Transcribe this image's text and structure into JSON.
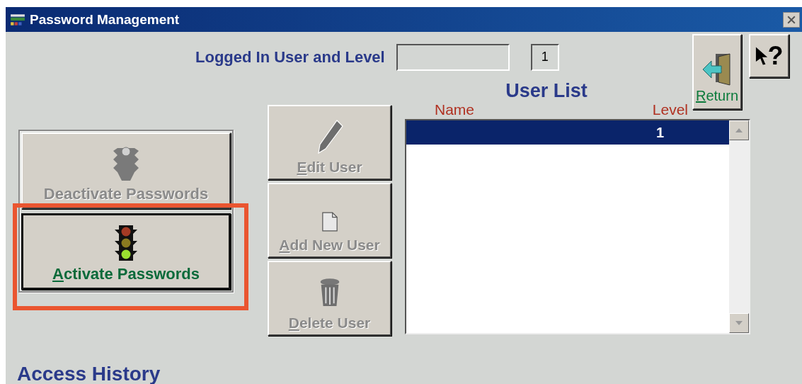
{
  "window": {
    "title": "Password Management"
  },
  "login": {
    "label": "Logged In User and Level",
    "level": "1"
  },
  "side_buttons": [
    {
      "kind": "deactivate",
      "label": "Deactivate Passwords",
      "disabled": true
    },
    {
      "kind": "activate",
      "label": "Activate Passwords",
      "disabled": false
    }
  ],
  "user_buttons": [
    {
      "kind": "edit",
      "label": "Edit User",
      "disabled": true
    },
    {
      "kind": "add",
      "label": "Add New User",
      "disabled": true
    },
    {
      "kind": "delete",
      "label": "Delete User",
      "disabled": true
    }
  ],
  "return_button": {
    "label": "Return",
    "disabled": false
  },
  "help_button": {
    "glyph": "?"
  },
  "user_list": {
    "title": "User List",
    "columns": [
      "Name",
      "Level"
    ],
    "rows": [
      {
        "level": "1",
        "selected": true
      }
    ]
  },
  "access_history": {
    "title": "Access History"
  }
}
